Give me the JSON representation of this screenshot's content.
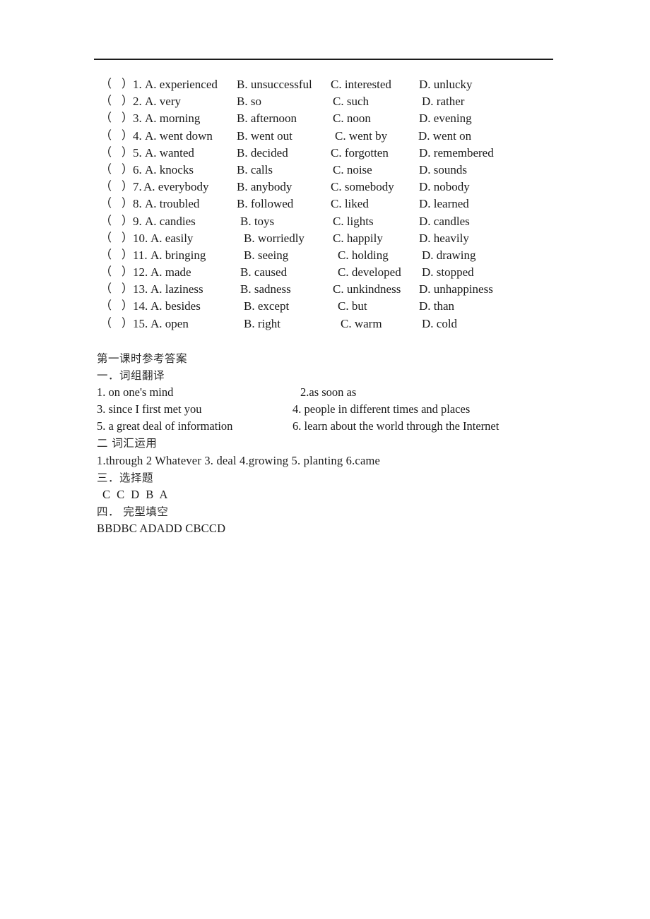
{
  "document": {
    "title": "第一课时参考答案",
    "rule_color": "#1c1c1c"
  },
  "cloze": {
    "paren_open": "（",
    "paren_close": "）",
    "rows": [
      {
        "num": "1.",
        "a": "A. experienced",
        "b": "B. unsuccessful",
        "c": "C. interested",
        "d": "D. unlucky"
      },
      {
        "num": "2.",
        "a": "A. very",
        "b": "B. so",
        "c": "C. such",
        "d": "D. rather"
      },
      {
        "num": "3.",
        "a": "A. morning",
        "b": "B. afternoon",
        "c": "C. noon",
        "d": "D. evening"
      },
      {
        "num": "4.",
        "a": "A. went down",
        "b": "B. went out",
        "c": "C. went by",
        "d": "D. went on"
      },
      {
        "num": "5.",
        "a": "A. wanted",
        "b": "B. decided",
        "c": "C. forgotten",
        "d": "D. remembered"
      },
      {
        "num": "6.",
        "a": "A. knocks",
        "b": "B. calls",
        "c": "C. noise",
        "d": "D. sounds"
      },
      {
        "num": "7.",
        "a": "A. everybody",
        "b": "B. anybody",
        "c": "C. somebody",
        "d": "D. nobody"
      },
      {
        "num": "8.",
        "a": "A. troubled",
        "b": "B. followed",
        "c": "C. liked",
        "d": "D. learned"
      },
      {
        "num": "9.",
        "a": "A. candies",
        "b": "B. toys",
        "c": "C. lights",
        "d": "D. candles"
      },
      {
        "num": "10.",
        "a": "A. easily",
        "b": "B. worriedly",
        "c": "C. happily",
        "d": "D. heavily"
      },
      {
        "num": "11.",
        "a": "A. bringing",
        "b": "B. seeing",
        "c": "C. holding",
        "d": "D. drawing"
      },
      {
        "num": "12.",
        "a": "A. made",
        "b": "B. caused",
        "c": "C. developed",
        "d": "D. stopped"
      },
      {
        "num": "13.",
        "a": "A. laziness",
        "b": "B. sadness",
        "c": "C. unkindness",
        "d": "D. unhappiness"
      },
      {
        "num": "14.",
        "a": "A. besides",
        "b": "B. except",
        "c": "C. but",
        "d": "D. than"
      },
      {
        "num": "15.",
        "a": "A. open",
        "b": "B. right",
        "c": "C. warm",
        "d": "D. cold"
      }
    ]
  },
  "answer_key": {
    "heading": "第一课时参考答案",
    "section_1": {
      "heading": "一．词组翻译",
      "pairs": [
        {
          "left": "1. on one's mind",
          "right": "2.as soon as"
        },
        {
          "left": "3. since I first met you",
          "right": "4. people in different times and places"
        },
        {
          "left": "5. a great deal of information",
          "right": "6. learn about the world through the Internet"
        }
      ]
    },
    "section_2": {
      "heading": "二 词汇运用",
      "answers": "1.through    2 Whatever 3. deal    4.growing 5. planting    6.came"
    },
    "section_3": {
      "heading": "三．选择题",
      "answers": "C C D B A"
    },
    "section_4": {
      "heading": "四．  完型填空",
      "answers": "BBDBC     ADADD     CBCCD"
    }
  }
}
